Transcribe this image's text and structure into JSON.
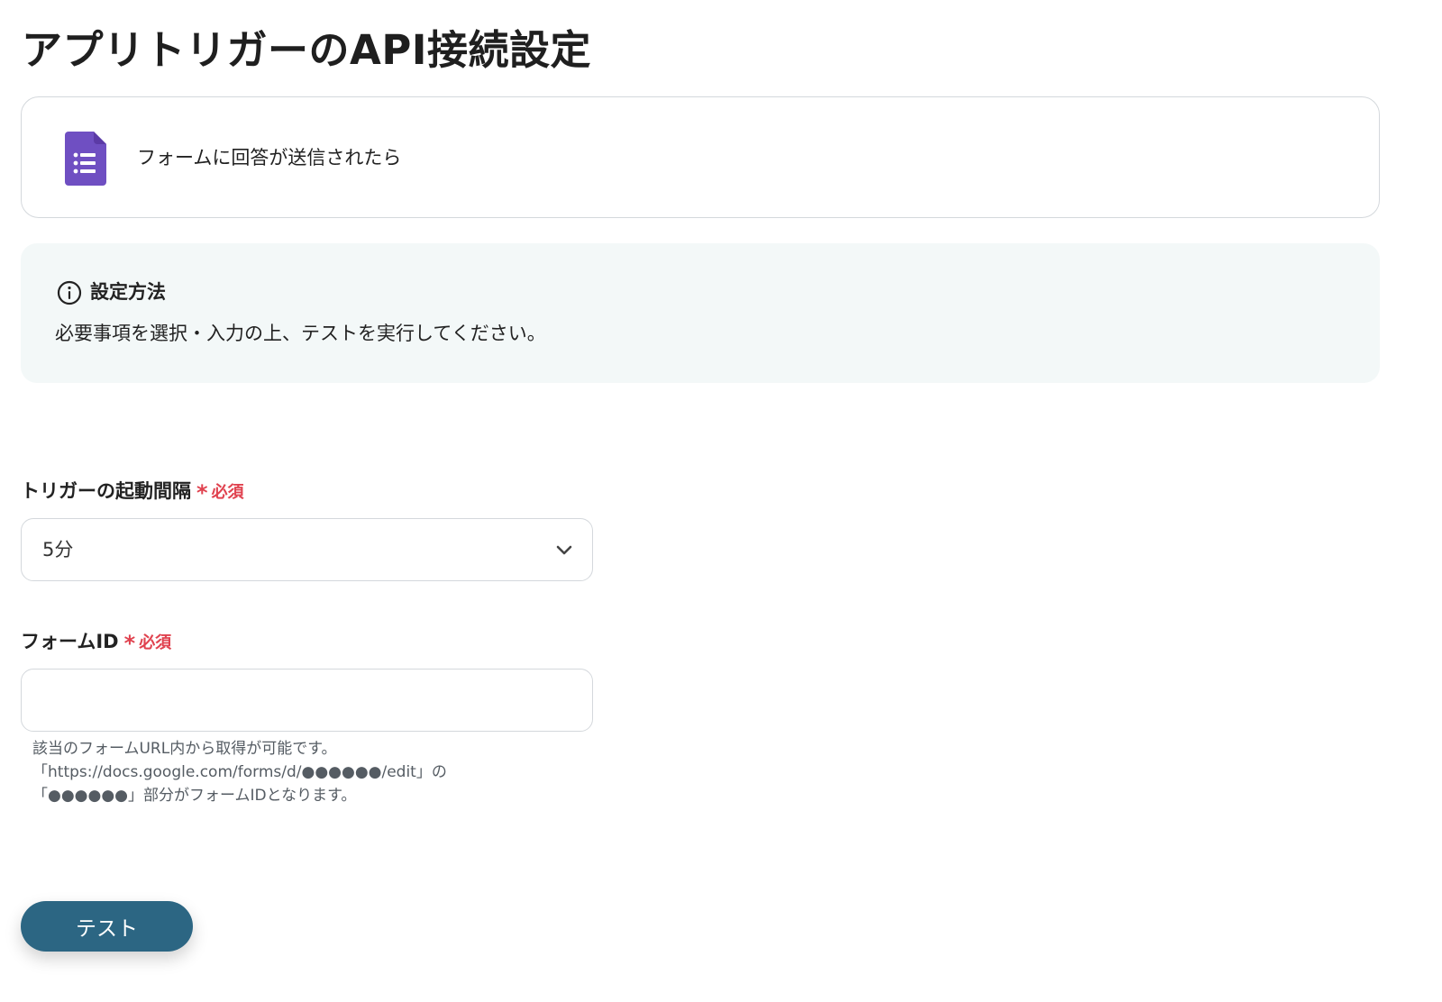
{
  "page": {
    "title": "アプリトリガーのAPI接続設定"
  },
  "trigger": {
    "icon": "google-forms-icon",
    "label": "フォームに回答が送信されたら"
  },
  "info": {
    "icon": "info-circle-icon",
    "title": "設定方法",
    "description": "必要事項を選択・入力の上、テストを実行してください。"
  },
  "fields": {
    "interval": {
      "label": "トリガーの起動間隔",
      "required_star": "*",
      "required_text": "必須",
      "value": "5分"
    },
    "form_id": {
      "label": "フォームID",
      "required_star": "*",
      "required_text": "必須",
      "value": "",
      "placeholder": "",
      "help": [
        "該当のフォームURL内から取得が可能です。",
        "「https://docs.google.com/forms/d/●●●●●●/edit」の",
        "「●●●●●●」部分がフォームIDとなります。"
      ]
    }
  },
  "actions": {
    "test_label": "テスト"
  },
  "colors": {
    "required": "#e0424f",
    "button": "#2c6683",
    "info_bg": "#f3f8f8",
    "forms_icon": "#6f4fc2"
  }
}
